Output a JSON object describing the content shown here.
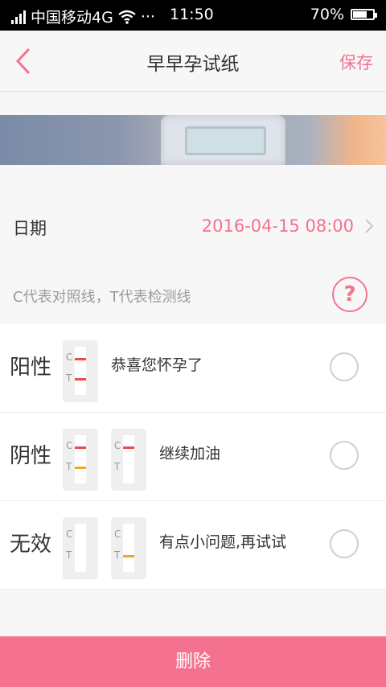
{
  "status": {
    "carrier": "中国移动4G",
    "time": "11:50",
    "battery": "70%",
    "battery_level": 0.7
  },
  "nav": {
    "title": "早早孕试纸",
    "save": "保存"
  },
  "date": {
    "label": "日期",
    "value": "2016-04-15 08:00"
  },
  "hint": {
    "text": "C代表对照线，T代表检测线",
    "help": "?"
  },
  "options": [
    {
      "name": "阳性",
      "desc": "恭喜您怀孕了",
      "strips": [
        {
          "c": "#f0494f",
          "t": "#f0494f"
        }
      ]
    },
    {
      "name": "阴性",
      "desc": "继续加油",
      "strips": [
        {
          "c": "#f0494f",
          "t": "#f5a623"
        },
        {
          "c": "#f0494f",
          "t": ""
        }
      ]
    },
    {
      "name": "无效",
      "desc": "有点小问题,再试试",
      "strips": [
        {
          "c": "",
          "t": ""
        },
        {
          "c": "",
          "t": "#f5a623"
        }
      ]
    }
  ],
  "strip_labels": {
    "c": "C",
    "t": "T"
  },
  "delete": "删除",
  "colors": {
    "accent": "#f4728f"
  }
}
